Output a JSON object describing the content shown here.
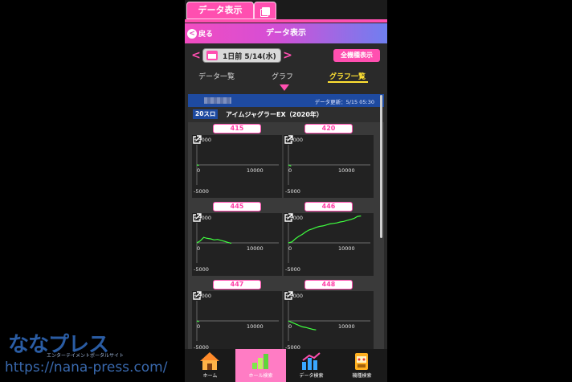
{
  "top_tab": {
    "label": "データ表示"
  },
  "header": {
    "back_label": "戻る",
    "back_glyph": "<",
    "title": "データ表示"
  },
  "date_nav": {
    "prev_glyph": "<",
    "next_glyph": ">",
    "date": "1日前 5/14(水)",
    "all_models_label": "全機種表示"
  },
  "tabs": [
    {
      "label": "データ一覧",
      "active": false
    },
    {
      "label": "グラフ",
      "active": false
    },
    {
      "label": "グラフ一覧",
      "active": true
    }
  ],
  "hall": {
    "updated": "データ更新：5/15 05:30"
  },
  "model": {
    "badge": "20スロ",
    "name": "アイムジャグラーEX（2020年）"
  },
  "graph_labels": {
    "top": "+5000",
    "bottom": "-5000",
    "zero": "0",
    "xmax": "10000"
  },
  "colors": {
    "accent": "#ff4fb0",
    "line": "#3fff3f",
    "active_tab": "#ffe133"
  },
  "machines": [
    {
      "number": "415",
      "x": [
        0,
        300
      ],
      "y": [
        0,
        -120
      ]
    },
    {
      "number": "420",
      "x": [
        0,
        400
      ],
      "y": [
        0,
        -260
      ]
    },
    {
      "number": "445",
      "x": [
        0,
        500,
        1000,
        1500,
        2000,
        2500,
        3000,
        3500,
        4000,
        4500,
        5000
      ],
      "y": [
        0,
        400,
        1100,
        900,
        800,
        600,
        700,
        500,
        300,
        100,
        -100
      ]
    },
    {
      "number": "446",
      "x": [
        0,
        500,
        1000,
        1500,
        2000,
        2500,
        3000,
        3500,
        4000,
        4500,
        5000,
        5500,
        6000,
        6500,
        7000,
        7500,
        8000,
        8500,
        9000,
        9500,
        10000,
        10500
      ],
      "y": [
        0,
        200,
        800,
        1300,
        1700,
        2200,
        2600,
        2800,
        3100,
        3300,
        3400,
        3600,
        3800,
        3900,
        4000,
        4200,
        4300,
        4500,
        4700,
        4900,
        5300,
        5400
      ]
    },
    {
      "number": "447",
      "x": [
        0,
        300
      ],
      "y": [
        0,
        -180
      ]
    },
    {
      "number": "448",
      "x": [
        0,
        500,
        1000,
        1500,
        2000,
        2500,
        3000,
        3500,
        4000
      ],
      "y": [
        0,
        -300,
        -600,
        -900,
        -1200,
        -1300,
        -1500,
        -1700,
        -1800
      ]
    }
  ],
  "bottom_nav": [
    {
      "label": "ホーム",
      "icon": "house-icon",
      "active": false
    },
    {
      "label": "ホール検索",
      "icon": "hall-search-icon",
      "active": true
    },
    {
      "label": "データ検索",
      "icon": "bar-chart-icon",
      "active": false
    },
    {
      "label": "機種検索",
      "icon": "slot-machine-icon",
      "active": false
    }
  ],
  "watermark": {
    "logo": "ななプレス",
    "sub": "エンターテイメントポータルサイト",
    "url": "https://nana-press.com/"
  }
}
